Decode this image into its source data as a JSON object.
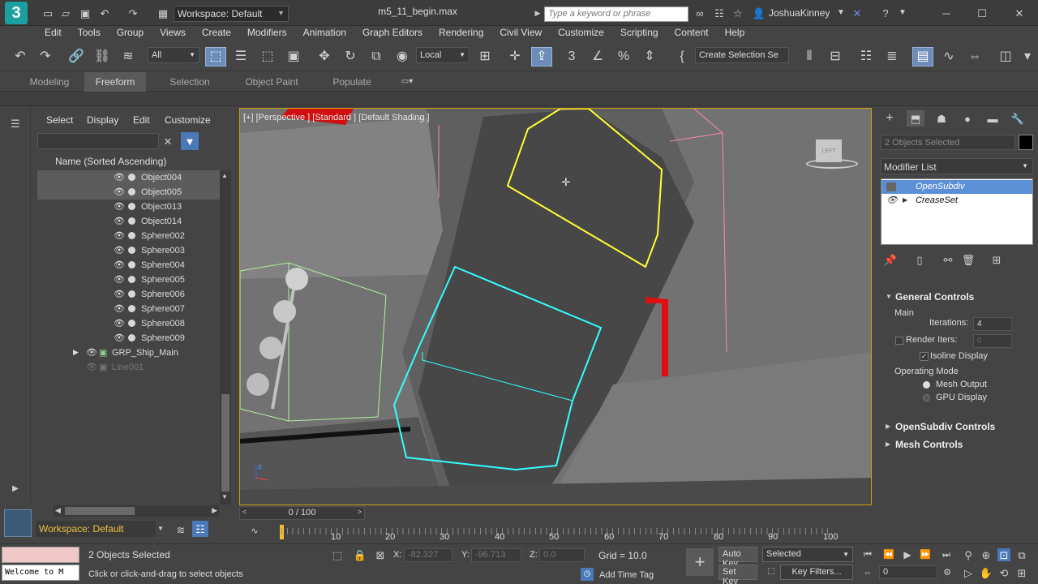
{
  "title_bar": {
    "workspace_label": "Workspace: Default",
    "file_name": "m5_11_begin.max",
    "search_placeholder": "Type a keyword or phrase",
    "user_name": "JoshuaKinney"
  },
  "menu": [
    "Edit",
    "Tools",
    "Group",
    "Views",
    "Create",
    "Modifiers",
    "Animation",
    "Graph Editors",
    "Rendering",
    "Civil View",
    "Customize",
    "Scripting",
    "Content",
    "Help"
  ],
  "toolbar": {
    "filter_value": "All",
    "coord_system": "Local",
    "selection_set_placeholder": "Create Selection Se"
  },
  "ribbon_tabs": [
    "Modeling",
    "Freeform",
    "Selection",
    "Object Paint",
    "Populate"
  ],
  "ribbon_active": "Freeform",
  "scene_explorer": {
    "tabs": [
      "Select",
      "Display",
      "Edit",
      "Customize"
    ],
    "column_header": "Name (Sorted Ascending)",
    "rows": [
      {
        "name": "Object004",
        "selected": true
      },
      {
        "name": "Object005",
        "selected": true
      },
      {
        "name": "Object013",
        "selected": false
      },
      {
        "name": "Object014",
        "selected": false
      },
      {
        "name": "Sphere002",
        "selected": false
      },
      {
        "name": "Sphere003",
        "selected": false
      },
      {
        "name": "Sphere004",
        "selected": false
      },
      {
        "name": "Sphere005",
        "selected": false
      },
      {
        "name": "Sphere006",
        "selected": false
      },
      {
        "name": "Sphere007",
        "selected": false
      },
      {
        "name": "Sphere008",
        "selected": false
      },
      {
        "name": "Sphere009",
        "selected": false
      }
    ],
    "group_row": "GRP_Ship_Main",
    "line_row": "Line001"
  },
  "viewport": {
    "label": "[+] [Perspective ] [Standard ] [Default Shading ]",
    "viewcube_label": "LEFT"
  },
  "command_panel": {
    "objects_selected": "2 Objects Selected",
    "modifier_list": "Modifier List",
    "stack": [
      "OpenSubdiv",
      "CreaseSet"
    ],
    "general_controls": "General Controls",
    "main_label": "Main",
    "iterations_label": "Iterations:",
    "iterations_value": "4",
    "render_iters_label": "Render Iters:",
    "render_iters_value": "0",
    "isoline_label": "Isoline Display",
    "operating_mode_label": "Operating Mode",
    "mesh_output_label": "Mesh Output",
    "gpu_display_label": "GPU Display",
    "opensubdiv_controls": "OpenSubdiv Controls",
    "mesh_controls": "Mesh Controls"
  },
  "timeline": {
    "frame_display": "0 / 100",
    "ticks": [
      "10",
      "20",
      "30",
      "40",
      "50",
      "60",
      "70",
      "80",
      "90",
      "100"
    ]
  },
  "status": {
    "workspace": "Workspace: Default",
    "maxscript_text": "Welcome to M",
    "selected_count": "2 Objects Selected",
    "prompt": "Click or click-and-drag to select objects",
    "x_label": "X:",
    "x_value": "-82.327",
    "y_label": "Y:",
    "y_value": "-96.713",
    "z_label": "Z:",
    "z_value": "0.0",
    "grid": "Grid = 10.0",
    "add_time_tag": "Add Time Tag",
    "auto_key": "Auto Key",
    "set_key": "Set Key",
    "selected_dd": "Selected",
    "key_filters": "Key Filters...",
    "frame_value": "0"
  },
  "colors": {
    "accent": "#5b8fd6",
    "viewport_border": "#d0a010",
    "selection_yellow": "#ffff33",
    "selection_cyan": "#33ffff"
  }
}
